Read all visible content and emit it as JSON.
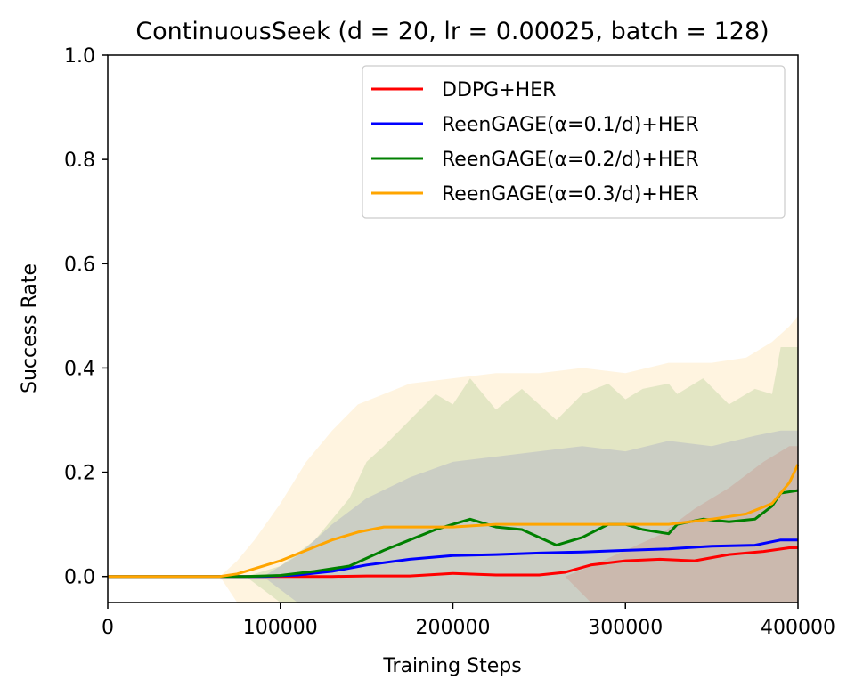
{
  "chart_data": {
    "type": "line",
    "title": "ContinuousSeek (d = 20, lr = 0.00025, batch = 128)",
    "xlabel": "Training Steps",
    "ylabel": "Success Rate",
    "xlim": [
      0,
      400000
    ],
    "ylim": [
      -0.05,
      1.0
    ],
    "xticks": [
      0,
      100000,
      200000,
      300000,
      400000
    ],
    "xtick_labels": [
      "0",
      "100000",
      "200000",
      "300000",
      "400000"
    ],
    "yticks": [
      0.0,
      0.2,
      0.4,
      0.6,
      0.8,
      1.0
    ],
    "ytick_labels": [
      "0.0",
      "0.2",
      "0.4",
      "0.6",
      "0.8",
      "1.0"
    ],
    "grid": false,
    "legend_position": "top-right",
    "series": [
      {
        "name": "DDPG+HER",
        "color": "#ff0000",
        "x": [
          0,
          100000,
          130000,
          150000,
          175000,
          200000,
          225000,
          250000,
          265000,
          280000,
          300000,
          320000,
          340000,
          360000,
          380000,
          395000,
          400000
        ],
        "values": [
          0.0,
          0.0,
          0.0,
          0.001,
          0.001,
          0.006,
          0.003,
          0.003,
          0.008,
          0.022,
          0.03,
          0.033,
          0.03,
          0.042,
          0.048,
          0.055,
          0.055
        ],
        "band_upper": [
          0.0,
          0.0,
          0.0,
          0.0,
          0.0,
          0.0,
          0.0,
          0.0,
          0.0,
          0.02,
          0.05,
          0.08,
          0.13,
          0.17,
          0.22,
          0.25,
          0.25
        ],
        "band_lower": [
          0.0,
          0.0,
          0.0,
          0.0,
          0.0,
          0.0,
          0.0,
          0.0,
          0.0,
          -0.05,
          -0.05,
          -0.05,
          -0.05,
          -0.05,
          -0.05,
          -0.05,
          -0.05
        ]
      },
      {
        "name": "ReenGAGE(α=0.1/d)+HER",
        "color": "#0000ff",
        "x": [
          0,
          90000,
          110000,
          130000,
          150000,
          175000,
          200000,
          225000,
          250000,
          275000,
          300000,
          325000,
          350000,
          375000,
          390000,
          400000
        ],
        "values": [
          0.0,
          0.0,
          0.003,
          0.01,
          0.022,
          0.033,
          0.04,
          0.042,
          0.045,
          0.047,
          0.05,
          0.053,
          0.058,
          0.06,
          0.07,
          0.07
        ],
        "band_upper": [
          0.0,
          0.0,
          0.04,
          0.1,
          0.15,
          0.19,
          0.22,
          0.23,
          0.24,
          0.25,
          0.24,
          0.26,
          0.25,
          0.27,
          0.28,
          0.28
        ],
        "band_lower": [
          0.0,
          0.0,
          -0.05,
          -0.05,
          -0.05,
          -0.05,
          -0.05,
          -0.05,
          -0.05,
          -0.05,
          -0.05,
          -0.05,
          -0.05,
          -0.05,
          -0.05,
          -0.05
        ]
      },
      {
        "name": "ReenGAGE(α=0.2/d)+HER",
        "color": "#008000",
        "x": [
          0,
          80000,
          100000,
          120000,
          140000,
          150000,
          160000,
          175000,
          190000,
          200000,
          210000,
          225000,
          240000,
          250000,
          260000,
          275000,
          290000,
          300000,
          310000,
          325000,
          330000,
          345000,
          360000,
          375000,
          385000,
          390000,
          400000
        ],
        "values": [
          0.0,
          0.0,
          0.002,
          0.01,
          0.02,
          0.035,
          0.05,
          0.07,
          0.09,
          0.1,
          0.11,
          0.095,
          0.09,
          0.075,
          0.06,
          0.075,
          0.1,
          0.1,
          0.09,
          0.082,
          0.1,
          0.11,
          0.105,
          0.11,
          0.135,
          0.16,
          0.165
        ],
        "band_upper": [
          0.0,
          0.0,
          0.02,
          0.07,
          0.15,
          0.22,
          0.25,
          0.3,
          0.35,
          0.33,
          0.38,
          0.32,
          0.36,
          0.33,
          0.3,
          0.35,
          0.37,
          0.34,
          0.36,
          0.37,
          0.35,
          0.38,
          0.33,
          0.36,
          0.35,
          0.44,
          0.44
        ],
        "band_lower": [
          0.0,
          0.0,
          -0.05,
          -0.05,
          -0.05,
          -0.05,
          -0.05,
          -0.05,
          -0.05,
          -0.05,
          -0.05,
          -0.05,
          -0.05,
          -0.05,
          -0.05,
          -0.05,
          -0.05,
          -0.05,
          -0.05,
          -0.05,
          -0.05,
          -0.05,
          -0.05,
          -0.05,
          -0.05,
          -0.05,
          -0.05
        ]
      },
      {
        "name": "ReenGAGE(α=0.3/d)+HER",
        "color": "#ffa500",
        "x": [
          0,
          65000,
          75000,
          85000,
          100000,
          115000,
          130000,
          145000,
          160000,
          175000,
          200000,
          225000,
          250000,
          275000,
          300000,
          325000,
          350000,
          370000,
          385000,
          395000,
          400000
        ],
        "values": [
          0.0,
          0.0,
          0.005,
          0.015,
          0.03,
          0.05,
          0.07,
          0.085,
          0.095,
          0.095,
          0.095,
          0.1,
          0.1,
          0.1,
          0.1,
          0.1,
          0.11,
          0.12,
          0.14,
          0.18,
          0.215
        ],
        "band_upper": [
          0.0,
          0.0,
          0.03,
          0.07,
          0.14,
          0.22,
          0.28,
          0.33,
          0.35,
          0.37,
          0.38,
          0.39,
          0.39,
          0.4,
          0.39,
          0.41,
          0.41,
          0.42,
          0.45,
          0.48,
          0.5
        ],
        "band_lower": [
          0.0,
          0.0,
          -0.05,
          -0.05,
          -0.05,
          -0.05,
          -0.05,
          -0.05,
          -0.05,
          -0.05,
          -0.05,
          -0.05,
          -0.05,
          -0.05,
          -0.05,
          -0.05,
          -0.05,
          -0.05,
          -0.05,
          -0.05,
          -0.05
        ]
      }
    ]
  }
}
